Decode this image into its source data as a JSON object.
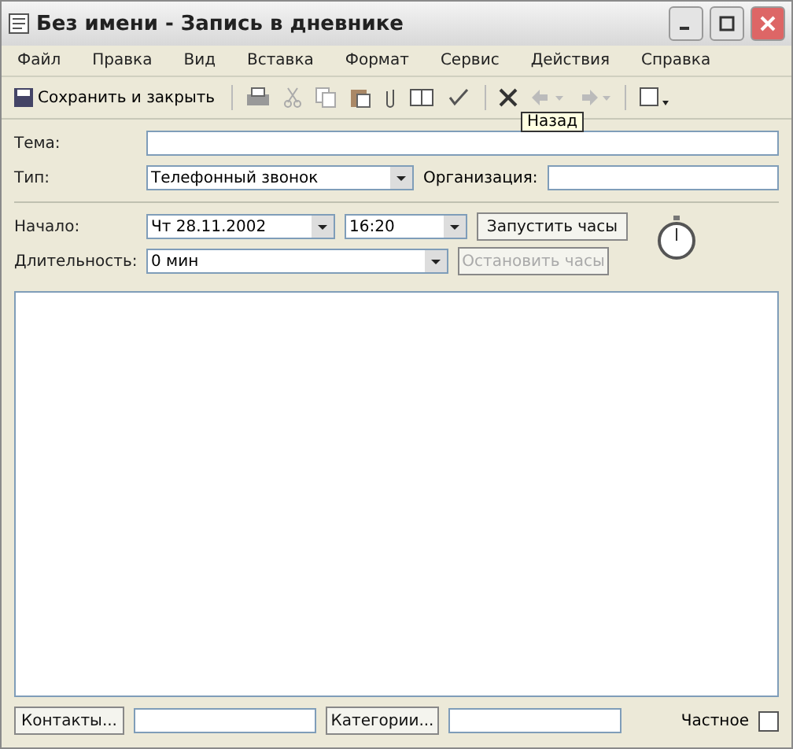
{
  "window": {
    "title": "Без имени - Запись в дневнике"
  },
  "menu": [
    "Файл",
    "Правка",
    "Вид",
    "Вставка",
    "Формат",
    "Сервис",
    "Действия",
    "Справка"
  ],
  "toolbar": {
    "save_label": "Сохранить и закрыть",
    "tooltip": "Назад"
  },
  "subject": {
    "label": "Тема:"
  },
  "type": {
    "label": "Тип:",
    "value": "Телефонный звонок"
  },
  "company": {
    "label": "Организация:"
  },
  "start": {
    "label": "Начало:",
    "date": "Чт 28.11.2002",
    "time": "16:20"
  },
  "duration": {
    "label": "Длительность:",
    "value": "0 мин"
  },
  "timer_buttons": [
    {
      "label": "Запустить часы",
      "disabled": false
    },
    {
      "label": "Остановить часы",
      "disabled": true
    }
  ],
  "footer": {
    "contacts": "Контакты...",
    "categories": "Категории...",
    "private_label": "Частное",
    "private_checked": false
  }
}
